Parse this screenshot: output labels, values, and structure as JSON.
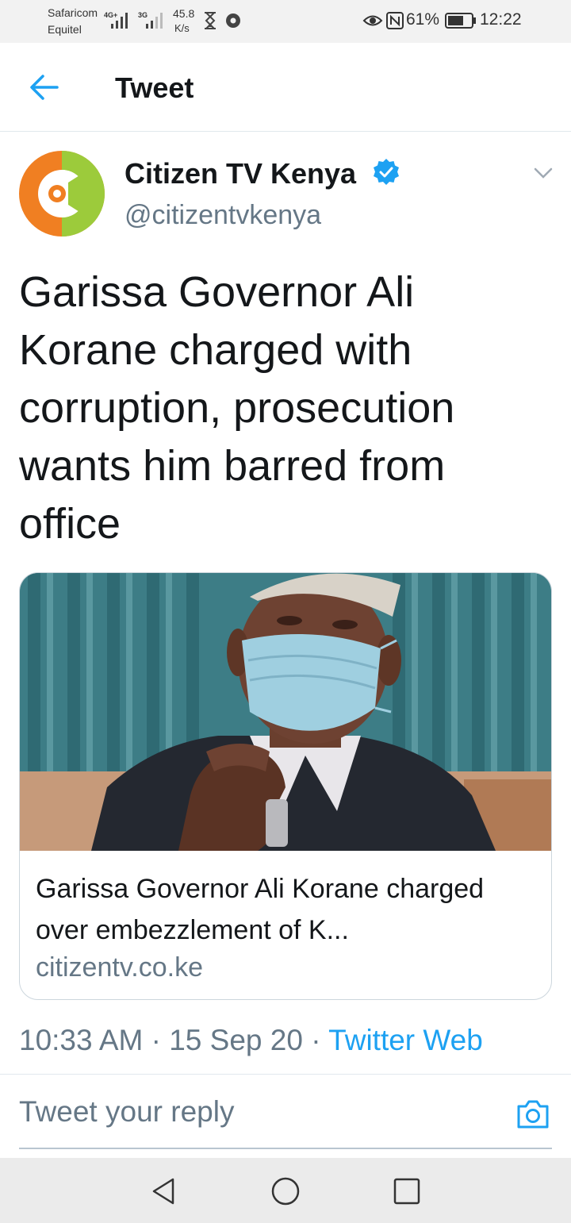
{
  "status_bar": {
    "carrier_line1": "Safaricom",
    "carrier_line2": "Equitel",
    "network_tag_1": "4G+",
    "network_tag_2": "3G",
    "speed_value": "45.8",
    "speed_unit": "K/s",
    "battery_percent": "61%",
    "time": "12:22",
    "icons": [
      "signal-icon",
      "hourglass-icon",
      "chrome-icon",
      "eye-icon",
      "nfc-icon",
      "battery-icon"
    ]
  },
  "header": {
    "title": "Tweet",
    "back_icon": "back-arrow-icon"
  },
  "tweet": {
    "author_name": "Citizen TV Kenya",
    "handle": "@citizentvkenya",
    "verified": true,
    "text": "Garissa Governor Ali Korane charged with corruption, prosecution wants him barred from office",
    "timestamp_time": "10:33 AM",
    "separator": " · ",
    "timestamp_date": "15 Sep 20",
    "source": "Twitter Web"
  },
  "link_card": {
    "title": "Garissa Governor Ali Korane charged over embezzlement of K...",
    "domain": "citizentv.co.ke",
    "image_subject": "man wearing a blue face mask and embroidered cap"
  },
  "reply": {
    "placeholder": "Tweet your reply",
    "value": ""
  },
  "colors": {
    "accent": "#1da1f2",
    "text_primary": "#14171a",
    "text_secondary": "#657786",
    "avatar_orange": "#f07f22",
    "avatar_green": "#9ccb3b"
  },
  "nav": {
    "icons": [
      "back-triangle-icon",
      "home-circle-icon",
      "recents-square-icon"
    ]
  }
}
